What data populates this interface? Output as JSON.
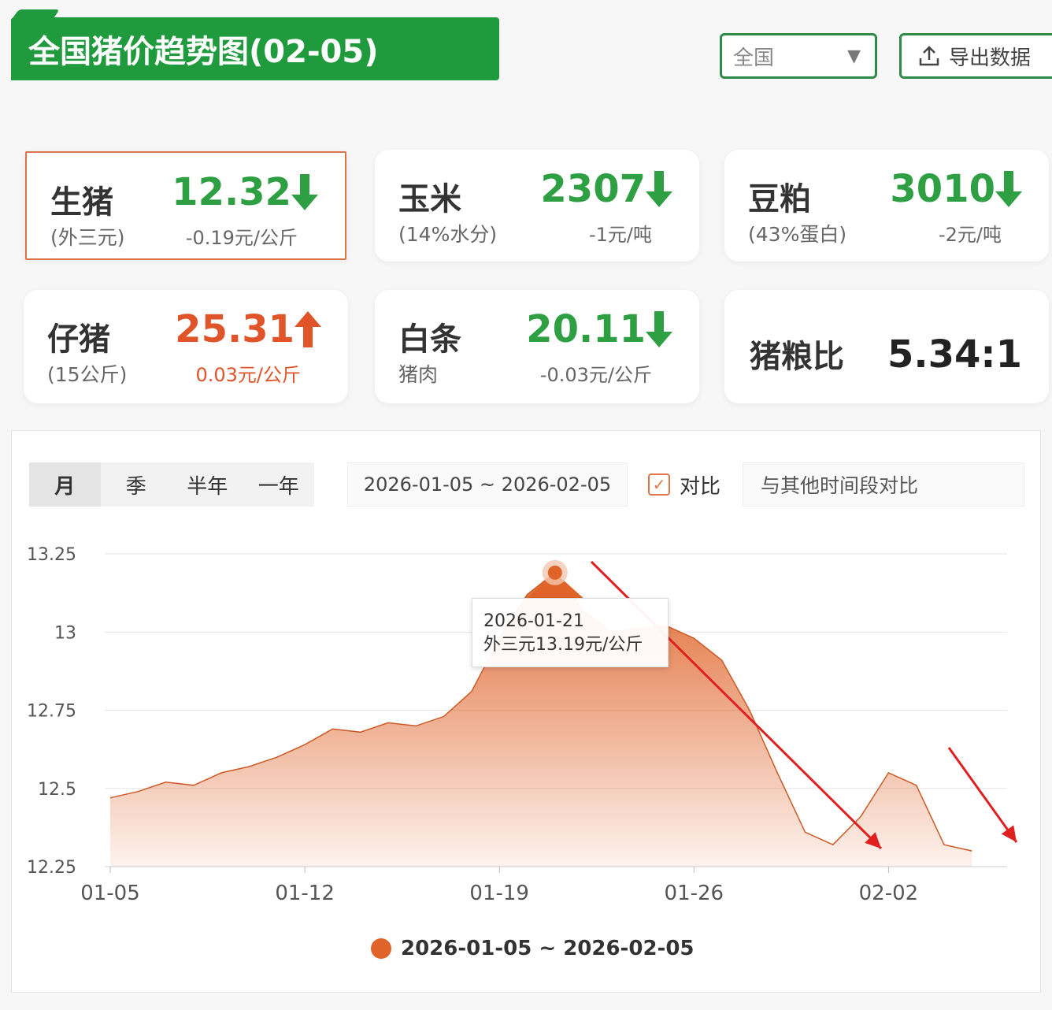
{
  "header": {
    "title": "全国猪价趋势图(02-05)",
    "region": "全国",
    "export_label": "导出数据"
  },
  "cards": [
    {
      "name": "生猪",
      "sub": "(外三元)",
      "price": "12.32",
      "trend": "down",
      "change": "-0.19元/公斤"
    },
    {
      "name": "玉米",
      "sub": "(14%水分)",
      "price": "2307",
      "trend": "down",
      "change": "-1元/吨"
    },
    {
      "name": "豆粕",
      "sub": "(43%蛋白)",
      "price": "3010",
      "trend": "down",
      "change": "-2元/吨"
    },
    {
      "name": "仔猪",
      "sub": "(15公斤)",
      "price": "25.31",
      "trend": "up",
      "change": "0.03元/公斤"
    },
    {
      "name": "白条",
      "sub": "猪肉",
      "price": "20.11",
      "trend": "down",
      "change": "-0.03元/公斤"
    }
  ],
  "ratio": {
    "name": "猪粮比",
    "value": "5.34:1"
  },
  "controls": {
    "tabs": [
      "月",
      "季",
      "半年",
      "一年"
    ],
    "date_range": "2026-01-05 ~ 2026-02-05",
    "compare_label": "对比",
    "compare_placeholder": "与其他时间段对比"
  },
  "tooltip": {
    "date": "2026-01-21",
    "text": "外三元13.19元/公斤"
  },
  "colors": {
    "green": "#1f9a3c",
    "down": "#2ea043",
    "up": "#e0542a",
    "series": "#e0642a",
    "annotation_arrow": "#e02020"
  },
  "chart_data": {
    "type": "area",
    "title": "",
    "xlabel": "",
    "ylabel": "",
    "ylim": [
      12.25,
      13.25
    ],
    "yticks": [
      "13.25",
      "13",
      "12.75",
      "12.5",
      "12.25"
    ],
    "xticks": [
      "01-05",
      "01-12",
      "01-19",
      "01-26",
      "02-02"
    ],
    "grid": true,
    "legend": "bottom-center",
    "x": [
      "01-05",
      "01-06",
      "01-07",
      "01-08",
      "01-09",
      "01-10",
      "01-11",
      "01-12",
      "01-13",
      "01-14",
      "01-15",
      "01-16",
      "01-17",
      "01-18",
      "01-19",
      "01-20",
      "01-21",
      "01-22",
      "01-23",
      "01-24",
      "01-25",
      "01-26",
      "01-27",
      "01-28",
      "01-29",
      "01-30",
      "01-31",
      "02-01",
      "02-02",
      "02-03",
      "02-04",
      "02-05"
    ],
    "series": [
      {
        "name": "2026-01-05 ~ 2026-02-05",
        "values": [
          12.47,
          12.49,
          12.52,
          12.51,
          12.55,
          12.57,
          12.6,
          12.64,
          12.69,
          12.68,
          12.71,
          12.7,
          12.73,
          12.81,
          12.98,
          13.12,
          13.19,
          13.07,
          13.0,
          13.01,
          13.02,
          12.98,
          12.91,
          12.75,
          12.55,
          12.36,
          12.32,
          12.41,
          12.55,
          12.51,
          12.32,
          12.3
        ]
      }
    ],
    "highlight_index": 16
  }
}
